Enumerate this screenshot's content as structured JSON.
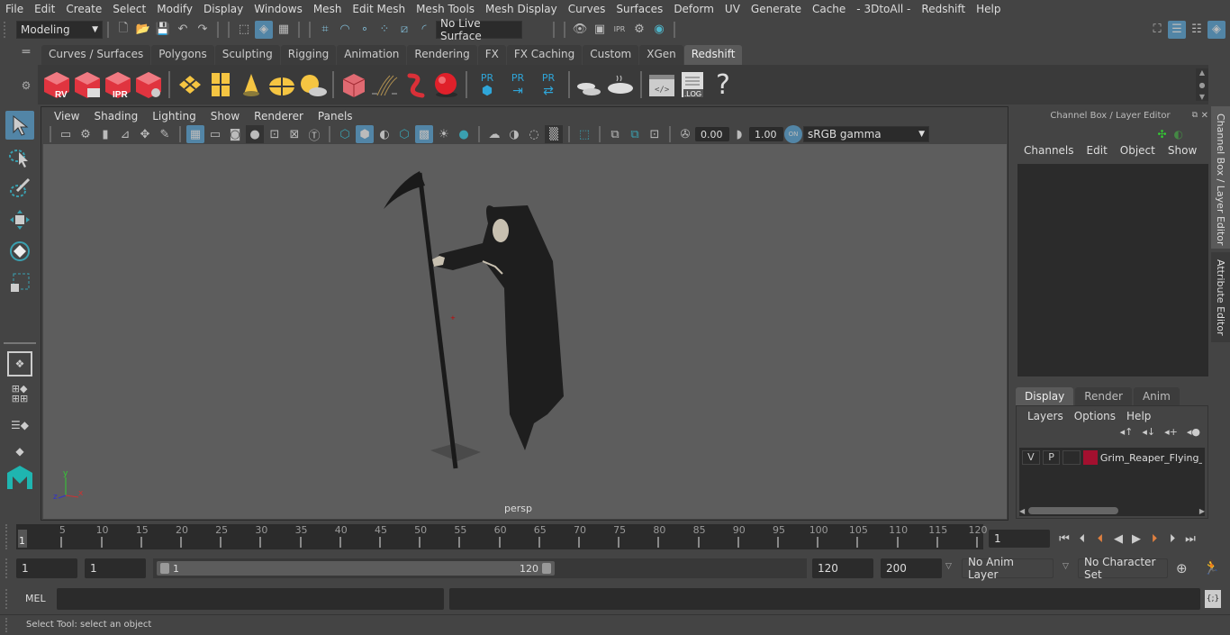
{
  "menubar": {
    "items": [
      "File",
      "Edit",
      "Create",
      "Select",
      "Modify",
      "Display",
      "Windows",
      "Mesh",
      "Edit Mesh",
      "Mesh Tools",
      "Mesh Display",
      "Curves",
      "Surfaces",
      "Deform",
      "UV",
      "Generate",
      "Cache",
      "- 3DtoAll -",
      "Redshift",
      "Help"
    ]
  },
  "statusline": {
    "workspace": "Modeling",
    "live_surface": "No Live Surface"
  },
  "shelf": {
    "tabs": [
      "Curves / Surfaces",
      "Polygons",
      "Sculpting",
      "Rigging",
      "Animation",
      "Rendering",
      "FX",
      "FX Caching",
      "Custom",
      "XGen",
      "Redshift"
    ],
    "active_tab": "Redshift",
    "icons": [
      {
        "name": "redshift-render-view-icon",
        "label": "RV"
      },
      {
        "name": "redshift-batch-render-icon",
        "label": ""
      },
      {
        "name": "redshift-ipr-icon",
        "label": "IPR"
      },
      {
        "name": "redshift-render-settings-icon",
        "label": ""
      },
      {
        "name": "redshift-area-light-icon",
        "label": ""
      },
      {
        "name": "redshift-portal-light-icon",
        "label": ""
      },
      {
        "name": "redshift-spot-light-icon",
        "label": ""
      },
      {
        "name": "redshift-dome-light-icon",
        "label": ""
      },
      {
        "name": "redshift-sun-sky-icon",
        "label": ""
      },
      {
        "name": "redshift-proxy-icon",
        "label": ""
      },
      {
        "name": "redshift-hair-icon",
        "label": ""
      },
      {
        "name": "redshift-curve-icon",
        "label": ""
      },
      {
        "name": "redshift-sphere-icon",
        "label": ""
      },
      {
        "name": "proxy-create-icon",
        "label": "PR"
      },
      {
        "name": "proxy-export-icon",
        "label": "PR"
      },
      {
        "name": "proxy-swap-icon",
        "label": "PR"
      },
      {
        "name": "bake-multiple-icon",
        "label": ""
      },
      {
        "name": "bake-icon",
        "label": ""
      },
      {
        "name": "script-editor-icon",
        "label": ""
      },
      {
        "name": "log-icon",
        "label": ".LOG"
      },
      {
        "name": "help-icon",
        "label": "?"
      }
    ]
  },
  "viewport": {
    "menu": [
      "View",
      "Shading",
      "Lighting",
      "Show",
      "Renderer",
      "Panels"
    ],
    "exposure": "0.00",
    "gamma": "1.00",
    "color_space": "sRGB gamma",
    "color_mgmt_toggle": "ON",
    "camera_label": "persp",
    "axis": {
      "x": "x",
      "y": "y",
      "z": "z"
    }
  },
  "channel_box": {
    "title": "Channel Box / Layer Editor",
    "menu": [
      "Channels",
      "Edit",
      "Object",
      "Show"
    ],
    "layer_tabs": [
      "Display",
      "Render",
      "Anim"
    ],
    "active_layer_tab": "Display",
    "layer_menu": [
      "Layers",
      "Options",
      "Help"
    ],
    "layers": [
      {
        "visible": "V",
        "playback": "P",
        "color": "#a3102f",
        "name": "Grim_Reaper_Flying_Po"
      }
    ]
  },
  "side_tabs": [
    "Channel Box / Layer Editor",
    "Attribute Editor"
  ],
  "timeline": {
    "ticks": [
      5,
      10,
      15,
      20,
      25,
      30,
      35,
      40,
      45,
      50,
      55,
      60,
      65,
      70,
      75,
      80,
      85,
      90,
      95,
      100,
      105,
      110,
      115,
      120
    ],
    "start": 1,
    "end": 120,
    "current_frame": "1",
    "current_frame_marker": "1"
  },
  "range": {
    "start_time": "1",
    "playback_start": "1",
    "slider_start": "1",
    "slider_end": "120",
    "playback_end": "120",
    "end_time": "200",
    "anim_layer": "No Anim Layer",
    "character_set": "No Character Set"
  },
  "command_line": {
    "language": "MEL",
    "input": "",
    "output": ""
  },
  "help_line": "Select Tool: select an object",
  "colors": {
    "accent": "#5285a6",
    "layer_color": "#a3102f",
    "redshift_red": "#e0343f",
    "light_yellow": "#f5c542",
    "proxy_blue": "#2fa6d9"
  }
}
